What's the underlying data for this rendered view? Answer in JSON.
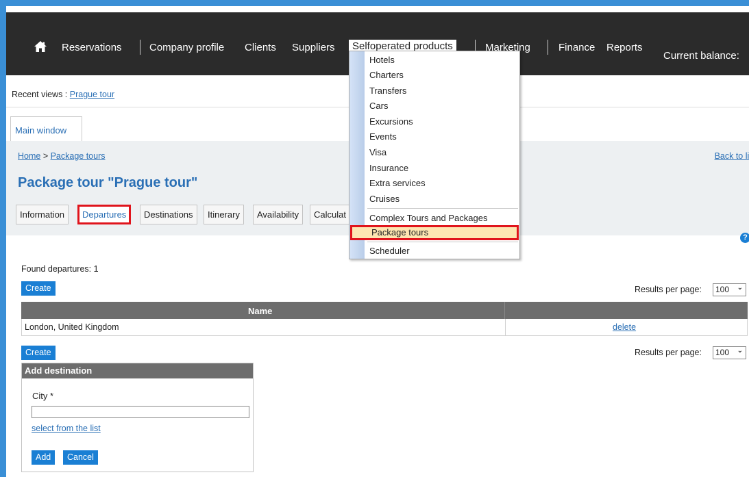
{
  "nav": {
    "home_icon": "home-icon",
    "items": [
      "Reservations",
      "Company profile",
      "Clients",
      "Suppliers",
      "Selfoperated products",
      "Marketing",
      "Finance",
      "Reports"
    ],
    "balance_label": "Current balance:"
  },
  "recent": {
    "label": "Recent views :",
    "link": "Prague tour"
  },
  "window_tab": "Main window",
  "breadcrumb": {
    "home": "Home",
    "separator": " > ",
    "current": "Package tours"
  },
  "back_link": "Back to list",
  "page_title": "Package tour \"Prague tour\"",
  "sub_tabs": [
    "Information",
    "Departures",
    "Destinations",
    "Itinerary",
    "Availability",
    "Calculat"
  ],
  "found_text": "Found departures: 1",
  "create_label": "Create",
  "results_per_page_label": "Results per page:",
  "results_per_page_value": "100",
  "table": {
    "header_name": "Name",
    "rows": [
      {
        "name": "London, United Kingdom",
        "action": "delete"
      }
    ]
  },
  "add_destination": {
    "title": "Add destination",
    "city_label": "City *",
    "city_value": "",
    "select_link": "select from the list",
    "add_label": "Add",
    "cancel_label": "Cancel"
  },
  "dropdown": {
    "items": [
      "Hotels",
      "Charters",
      "Transfers",
      "Cars",
      "Excursions",
      "Events",
      "Visa",
      "Insurance",
      "Extra services",
      "Cruises",
      "Complex Tours and Packages",
      "Package tours",
      "Scheduler"
    ],
    "highlighted": "Package tours"
  },
  "colors": {
    "accent": "#1a7fd4",
    "topbar": "#2b2b2b",
    "highlight_border": "#e0141c",
    "title_blue": "#2a6fb5"
  }
}
